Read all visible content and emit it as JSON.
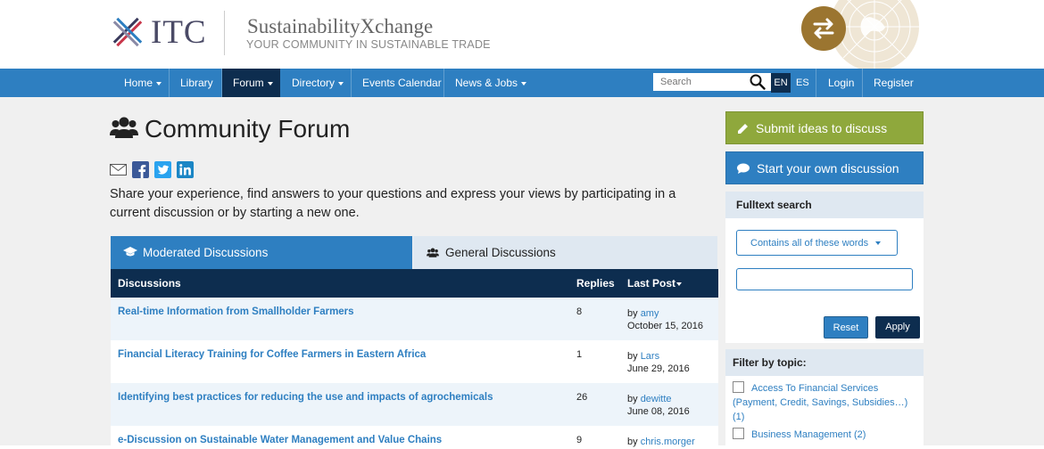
{
  "header": {
    "logo_text": "ITC",
    "site_title": "SustainabilityXchange",
    "tagline": "YOUR COMMUNITY IN SUSTAINABLE TRADE"
  },
  "nav": {
    "items": [
      {
        "label": "Home",
        "dropdown": true
      },
      {
        "label": "Library",
        "dropdown": false
      },
      {
        "label": "Forum",
        "dropdown": true,
        "active": true
      },
      {
        "label": "Directory",
        "dropdown": true
      },
      {
        "label": "Events Calendar",
        "dropdown": false
      },
      {
        "label": "News & Jobs",
        "dropdown": true
      }
    ],
    "search_placeholder": "Search",
    "lang_en": "EN",
    "lang_es": "ES",
    "login": "Login",
    "register": "Register"
  },
  "page": {
    "title": "Community Forum",
    "intro": "Share your experience, find answers to your questions and express your views by participating in a current discussion or by starting a new one."
  },
  "tabs": {
    "moderated": "Moderated Discussions",
    "general": "General Discussions"
  },
  "table": {
    "col_discussions": "Discussions",
    "col_replies": "Replies",
    "col_last_post": "Last Post",
    "rows": [
      {
        "title": "Real-time Information from Smallholder Farmers",
        "replies": "8",
        "by": "by",
        "user": "amy",
        "date": "October 15, 2016"
      },
      {
        "title": "Financial Literacy Training for Coffee Farmers in Eastern Africa",
        "replies": "1",
        "by": "by",
        "user": "Lars",
        "date": "June 29, 2016"
      },
      {
        "title": "Identifying best practices for reducing the use and impacts of agrochemicals",
        "replies": "26",
        "by": "by",
        "user": "dewitte",
        "date": "June 08, 2016"
      },
      {
        "title": "e-Discussion on Sustainable Water Management and Value Chains",
        "replies": "9",
        "by": "by",
        "user": "chris.morger",
        "date": ""
      }
    ]
  },
  "sidebar": {
    "submit_label": "Submit ideas to discuss",
    "start_label": "Start your own discussion",
    "fulltext_heading": "Fulltext search",
    "match_mode": "Contains all of these words",
    "reset": "Reset",
    "apply": "Apply",
    "topic_heading": "Filter by topic:",
    "topic1_line1": "Access To Financial Services",
    "topic1_line2": "(Payment, Credit, Savings, Subsidies…)",
    "topic1_line3": "(1)",
    "topic2": "Business Management (2)"
  },
  "colors": {
    "nav_blue": "#2e7fc1",
    "dark_navy": "#0d2d4f",
    "submit_green": "#8fa83c",
    "gold": "#9b7530"
  }
}
